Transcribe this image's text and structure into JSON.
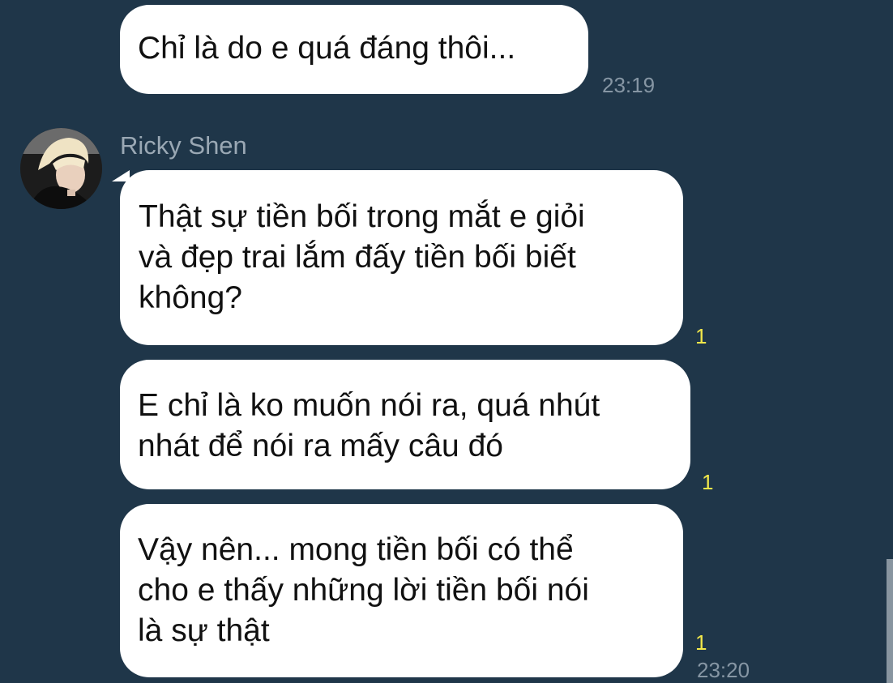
{
  "messages": {
    "m1": {
      "text": "Chỉ là do e quá đáng thôi...",
      "time": "23:19"
    },
    "sender_name": "Ricky Shen",
    "m2": {
      "lines": [
        "Thật sự tiền bối trong mắt e giỏi",
        "và đẹp trai lắm đấy tiền bối biết",
        "không?"
      ],
      "read": "1"
    },
    "m3": {
      "lines": [
        "E chỉ là ko muốn nói ra, quá nhút",
        "nhát để nói ra mấy câu đó"
      ],
      "read": "1"
    },
    "m4": {
      "lines": [
        "Vậy nên... mong tiền bối có thể",
        "cho e thấy những lời tiền bối nói",
        "là sự thật"
      ],
      "read": "1",
      "time": "23:20"
    }
  },
  "colors": {
    "background": "#1f3649",
    "bubble": "#ffffff",
    "read_count": "#f2e84a",
    "timestamp": "#8696a4",
    "sender": "#9aa8b4"
  }
}
